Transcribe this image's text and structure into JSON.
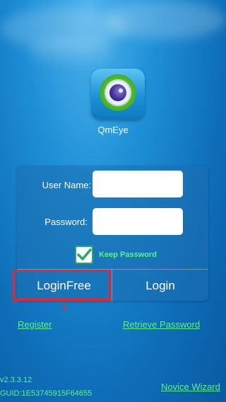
{
  "app": {
    "name": "QmEye",
    "icon": "camera-lens-icon"
  },
  "form": {
    "username_label": "User Name:",
    "password_label": "Password:",
    "username_value": "",
    "password_value": "",
    "keep_password_label": "Keep Password",
    "keep_password_checked": true
  },
  "buttons": {
    "login_free": "LoginFree",
    "login": "Login"
  },
  "annotation": {
    "marker_text": "1",
    "color": "#e8262c"
  },
  "links": {
    "register": "Register",
    "retrieve_password": "Retrieve Password",
    "novice_wizard": "Novice Wizard"
  },
  "footer": {
    "version": "v2.3.3.12",
    "guid": "GUID:1E53745915F64655"
  },
  "colors": {
    "accent_green": "#5ff08a",
    "highlight_red": "#e8262c",
    "background_blue": "#1d8fd6"
  }
}
